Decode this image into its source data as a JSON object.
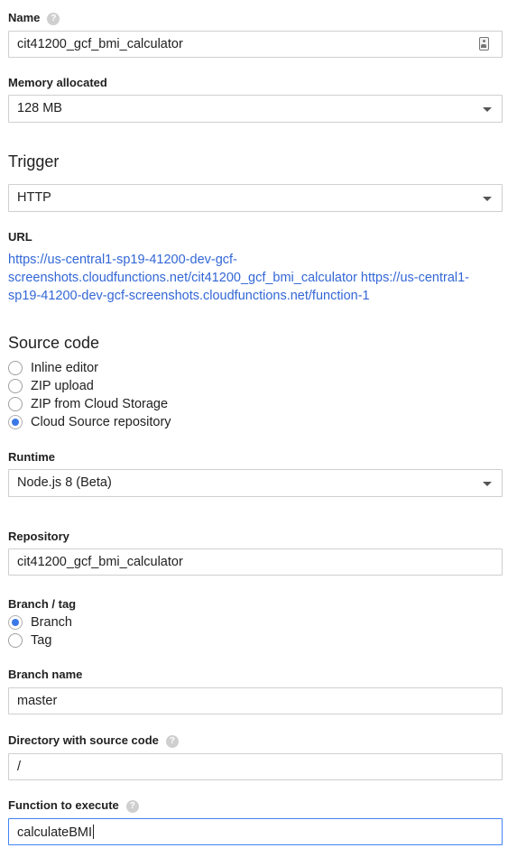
{
  "name": {
    "label": "Name",
    "value": "cit41200_gcf_bmi_calculator"
  },
  "memory": {
    "label": "Memory allocated",
    "value": "128 MB"
  },
  "trigger": {
    "heading": "Trigger",
    "value": "HTTP",
    "url_label": "URL",
    "url_line1": "https://us-central1-sp19-41200-dev-gcf-",
    "url_line2": "screenshots.cloudfunctions.net/cit41200_gcf_bmi_calculator https://us-central1-",
    "url_line3": "sp19-41200-dev-gcf-screenshots.cloudfunctions.net/function-1"
  },
  "source_code": {
    "heading": "Source code",
    "options": [
      {
        "label": "Inline editor",
        "checked": false
      },
      {
        "label": "ZIP upload",
        "checked": false
      },
      {
        "label": "ZIP from Cloud Storage",
        "checked": false
      },
      {
        "label": "Cloud Source repository",
        "checked": true
      }
    ]
  },
  "runtime": {
    "label": "Runtime",
    "value": "Node.js 8 (Beta)"
  },
  "repository": {
    "label": "Repository",
    "value": "cit41200_gcf_bmi_calculator"
  },
  "branch_tag": {
    "label": "Branch / tag",
    "options": [
      {
        "label": "Branch",
        "checked": true
      },
      {
        "label": "Tag",
        "checked": false
      }
    ]
  },
  "branch_name": {
    "label": "Branch name",
    "value": "master"
  },
  "directory": {
    "label": "Directory with source code",
    "value": "/"
  },
  "function": {
    "label": "Function to execute",
    "value": "calculateBMI"
  },
  "help_glyph": "?",
  "colors": {
    "link": "#3367d6",
    "radio_checked": "#3b78e7",
    "focus_border": "#4285f4"
  },
  "icons": [
    "help-icon",
    "contact-card-icon",
    "dropdown-caret-icon"
  ]
}
